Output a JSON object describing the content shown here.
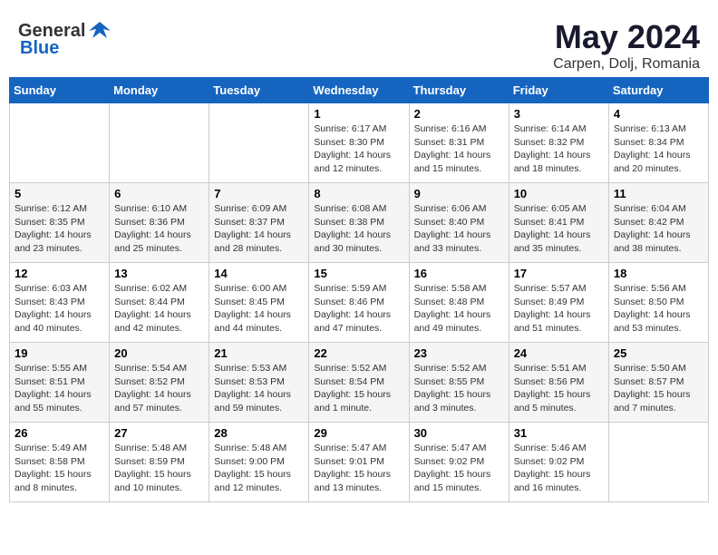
{
  "header": {
    "logo_general": "General",
    "logo_blue": "Blue",
    "title_month": "May 2024",
    "title_location": "Carpen, Dolj, Romania"
  },
  "calendar": {
    "headers": [
      "Sunday",
      "Monday",
      "Tuesday",
      "Wednesday",
      "Thursday",
      "Friday",
      "Saturday"
    ],
    "weeks": [
      [
        {
          "day": "",
          "content": ""
        },
        {
          "day": "",
          "content": ""
        },
        {
          "day": "",
          "content": ""
        },
        {
          "day": "1",
          "content": "Sunrise: 6:17 AM\nSunset: 8:30 PM\nDaylight: 14 hours\nand 12 minutes."
        },
        {
          "day": "2",
          "content": "Sunrise: 6:16 AM\nSunset: 8:31 PM\nDaylight: 14 hours\nand 15 minutes."
        },
        {
          "day": "3",
          "content": "Sunrise: 6:14 AM\nSunset: 8:32 PM\nDaylight: 14 hours\nand 18 minutes."
        },
        {
          "day": "4",
          "content": "Sunrise: 6:13 AM\nSunset: 8:34 PM\nDaylight: 14 hours\nand 20 minutes."
        }
      ],
      [
        {
          "day": "5",
          "content": "Sunrise: 6:12 AM\nSunset: 8:35 PM\nDaylight: 14 hours\nand 23 minutes."
        },
        {
          "day": "6",
          "content": "Sunrise: 6:10 AM\nSunset: 8:36 PM\nDaylight: 14 hours\nand 25 minutes."
        },
        {
          "day": "7",
          "content": "Sunrise: 6:09 AM\nSunset: 8:37 PM\nDaylight: 14 hours\nand 28 minutes."
        },
        {
          "day": "8",
          "content": "Sunrise: 6:08 AM\nSunset: 8:38 PM\nDaylight: 14 hours\nand 30 minutes."
        },
        {
          "day": "9",
          "content": "Sunrise: 6:06 AM\nSunset: 8:40 PM\nDaylight: 14 hours\nand 33 minutes."
        },
        {
          "day": "10",
          "content": "Sunrise: 6:05 AM\nSunset: 8:41 PM\nDaylight: 14 hours\nand 35 minutes."
        },
        {
          "day": "11",
          "content": "Sunrise: 6:04 AM\nSunset: 8:42 PM\nDaylight: 14 hours\nand 38 minutes."
        }
      ],
      [
        {
          "day": "12",
          "content": "Sunrise: 6:03 AM\nSunset: 8:43 PM\nDaylight: 14 hours\nand 40 minutes."
        },
        {
          "day": "13",
          "content": "Sunrise: 6:02 AM\nSunset: 8:44 PM\nDaylight: 14 hours\nand 42 minutes."
        },
        {
          "day": "14",
          "content": "Sunrise: 6:00 AM\nSunset: 8:45 PM\nDaylight: 14 hours\nand 44 minutes."
        },
        {
          "day": "15",
          "content": "Sunrise: 5:59 AM\nSunset: 8:46 PM\nDaylight: 14 hours\nand 47 minutes."
        },
        {
          "day": "16",
          "content": "Sunrise: 5:58 AM\nSunset: 8:48 PM\nDaylight: 14 hours\nand 49 minutes."
        },
        {
          "day": "17",
          "content": "Sunrise: 5:57 AM\nSunset: 8:49 PM\nDaylight: 14 hours\nand 51 minutes."
        },
        {
          "day": "18",
          "content": "Sunrise: 5:56 AM\nSunset: 8:50 PM\nDaylight: 14 hours\nand 53 minutes."
        }
      ],
      [
        {
          "day": "19",
          "content": "Sunrise: 5:55 AM\nSunset: 8:51 PM\nDaylight: 14 hours\nand 55 minutes."
        },
        {
          "day": "20",
          "content": "Sunrise: 5:54 AM\nSunset: 8:52 PM\nDaylight: 14 hours\nand 57 minutes."
        },
        {
          "day": "21",
          "content": "Sunrise: 5:53 AM\nSunset: 8:53 PM\nDaylight: 14 hours\nand 59 minutes."
        },
        {
          "day": "22",
          "content": "Sunrise: 5:52 AM\nSunset: 8:54 PM\nDaylight: 15 hours\nand 1 minute."
        },
        {
          "day": "23",
          "content": "Sunrise: 5:52 AM\nSunset: 8:55 PM\nDaylight: 15 hours\nand 3 minutes."
        },
        {
          "day": "24",
          "content": "Sunrise: 5:51 AM\nSunset: 8:56 PM\nDaylight: 15 hours\nand 5 minutes."
        },
        {
          "day": "25",
          "content": "Sunrise: 5:50 AM\nSunset: 8:57 PM\nDaylight: 15 hours\nand 7 minutes."
        }
      ],
      [
        {
          "day": "26",
          "content": "Sunrise: 5:49 AM\nSunset: 8:58 PM\nDaylight: 15 hours\nand 8 minutes."
        },
        {
          "day": "27",
          "content": "Sunrise: 5:48 AM\nSunset: 8:59 PM\nDaylight: 15 hours\nand 10 minutes."
        },
        {
          "day": "28",
          "content": "Sunrise: 5:48 AM\nSunset: 9:00 PM\nDaylight: 15 hours\nand 12 minutes."
        },
        {
          "day": "29",
          "content": "Sunrise: 5:47 AM\nSunset: 9:01 PM\nDaylight: 15 hours\nand 13 minutes."
        },
        {
          "day": "30",
          "content": "Sunrise: 5:47 AM\nSunset: 9:02 PM\nDaylight: 15 hours\nand 15 minutes."
        },
        {
          "day": "31",
          "content": "Sunrise: 5:46 AM\nSunset: 9:02 PM\nDaylight: 15 hours\nand 16 minutes."
        },
        {
          "day": "",
          "content": ""
        }
      ]
    ]
  }
}
